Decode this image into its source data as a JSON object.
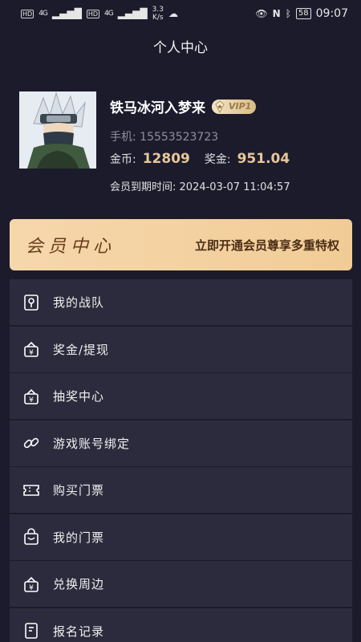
{
  "status_bar": {
    "network_badges": [
      "HD",
      "HD"
    ],
    "signal_labels": [
      "4G",
      "4G"
    ],
    "speed_value": "3.3",
    "speed_unit": "K/s",
    "battery": "58",
    "time": "09:07"
  },
  "header": {
    "title": "个人中心"
  },
  "profile": {
    "name": "铁马冰河入梦来",
    "vip_label": "VIP1",
    "phone_label": "手机:",
    "phone": "15553523723",
    "coin_label": "金币:",
    "coin_value": "12809",
    "bonus_label": "奖金:",
    "bonus_value": "951.04",
    "expire_label": "会员到期时间:",
    "expire_value": "2024-03-07 11:04:57"
  },
  "banner": {
    "title": "会员中心",
    "subtitle": "立即开通会员尊享多重特权"
  },
  "menu": [
    {
      "label": "我的战队",
      "icon": "team-icon"
    },
    {
      "label": "奖金/提现",
      "icon": "wallet-icon"
    },
    {
      "label": "抽奖中心",
      "icon": "lottery-icon"
    },
    {
      "label": "游戏账号绑定",
      "icon": "link-icon"
    },
    {
      "label": "购买门票",
      "icon": "ticket-icon"
    },
    {
      "label": "我的门票",
      "icon": "bag-icon"
    },
    {
      "label": "兑换周边",
      "icon": "exchange-icon"
    },
    {
      "label": "报名记录",
      "icon": "record-icon"
    }
  ],
  "colors": {
    "background": "#1c1b2c",
    "menu_item": "#2c2b3d",
    "gold": "#e6c79b",
    "banner": "#f3d19f"
  }
}
